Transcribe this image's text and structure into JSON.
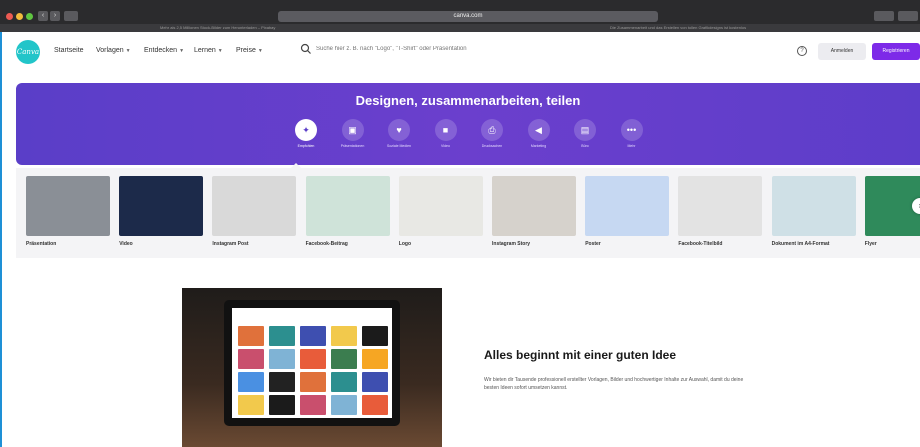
{
  "browser": {
    "url": "canva.com",
    "tab_left": "Mehr als 2,5 Millionen Stock-Bilder zum Herunterladen – Pixabay",
    "tab_right": "Die Zusammenarbeit und das Erstellen von tollen Grafikdesigns ist kostenlos",
    "back": "‹",
    "forward": "›"
  },
  "nav": {
    "logo": "Canva",
    "items": [
      "Startseite",
      "Vorlagen",
      "Entdecken",
      "Lernen",
      "Preise"
    ],
    "search_placeholder": "Suche hier z. B. nach \"Logo\", \"T-Shirt\" oder Präsentation",
    "help": "?",
    "login": "Anmelden",
    "register": "Registrieren"
  },
  "hero": {
    "title": "Designen, zusammenarbeiten, teilen",
    "categories": [
      {
        "label": "Empfohlen",
        "icon": "sparkle-icon",
        "glyph": "✦"
      },
      {
        "label": "Präsentationen",
        "icon": "presentation-icon",
        "glyph": "▣"
      },
      {
        "label": "Soziale Medien",
        "icon": "heart-icon",
        "glyph": "♥"
      },
      {
        "label": "Video",
        "icon": "video-icon",
        "glyph": "■"
      },
      {
        "label": "Drucksachen",
        "icon": "print-icon",
        "glyph": "⎙"
      },
      {
        "label": "Marketing",
        "icon": "megaphone-icon",
        "glyph": "◀"
      },
      {
        "label": "Büro",
        "icon": "briefcase-icon",
        "glyph": "▤"
      },
      {
        "label": "Mehr",
        "icon": "more-icon",
        "glyph": "•••"
      }
    ]
  },
  "designs": [
    {
      "label": "Präsentation",
      "color": "#8a8f96"
    },
    {
      "label": "Video",
      "color": "#1c2a4a"
    },
    {
      "label": "Instagram Post",
      "color": "#d9d9d9"
    },
    {
      "label": "Facebook-Beitrag",
      "color": "#cfe3d9"
    },
    {
      "label": "Logo",
      "color": "#e8e8e4"
    },
    {
      "label": "Instagram Story",
      "color": "#d6d2cc"
    },
    {
      "label": "Poster",
      "color": "#c6d8f2"
    },
    {
      "label": "Facebook-Titelbild",
      "color": "#e3e3e3"
    },
    {
      "label": "Dokument im A4-Format",
      "color": "#cfe0e6"
    },
    {
      "label": "Flyer",
      "color": "#2f8a5b"
    }
  ],
  "feature": {
    "title": "Alles beginnt mit einer guten Idee",
    "description": "Wir bieten dir Tausende professionell erstellter Vorlagen, Bilder und hochwertiger Inhalte zur Auswahl, damit du deine besten Ideen sofort umsetzen kannst."
  }
}
